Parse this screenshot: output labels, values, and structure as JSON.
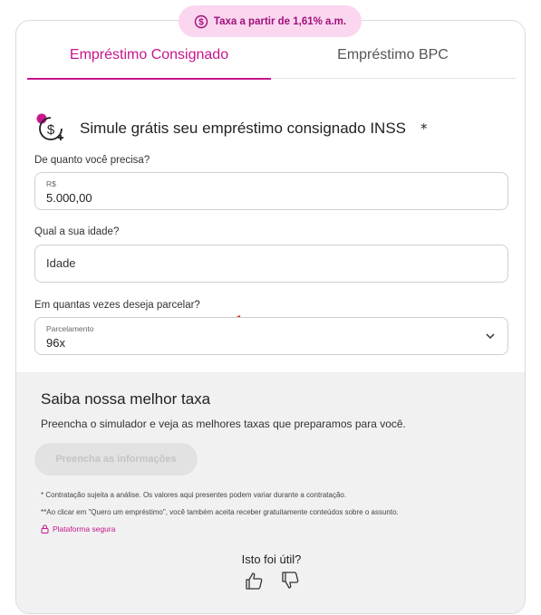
{
  "rate_pill": {
    "icon": "dollar-circle-icon",
    "text": "Taxa a partir de 1,61% a.m."
  },
  "tabs": [
    {
      "label": "Empréstimo Consignado",
      "active": true
    },
    {
      "label": "Empréstimo BPC",
      "active": false
    }
  ],
  "simulator": {
    "icon": "dollar-refresh-icon",
    "title": "Simule grátis seu empréstimo consignado INSS",
    "required_mark": "*"
  },
  "amount": {
    "label": "De quanto você precisa?",
    "currency": "R$",
    "value": "5.000,00"
  },
  "age": {
    "label": "Qual a sua idade?",
    "placeholder": "Idade"
  },
  "installments": {
    "label": "Em quantas vezes deseja parcelar?",
    "field_label": "Parcelamento",
    "value": "96x"
  },
  "best_rate": {
    "title": "Saiba nossa melhor taxa",
    "subtitle": "Preencha o simulador e veja as melhores taxas que preparamos para você.",
    "button_label": "Preencha as informações"
  },
  "notes": [
    "* Contratação sujeita a análise. Os valores aqui presentes podem variar durante a contratação.",
    "**Ao clicar em \"Quero um empréstimo\", você também aceita receber gratuitamente conteúdos sobre o assunto."
  ],
  "secure_label": "Plataforma segura",
  "feedback": {
    "question": "Isto foi útil?"
  },
  "colors": {
    "accent": "#c7168c",
    "pill_bg": "#fad6ef",
    "arrow": "#e01919",
    "section_bg": "#f1f1f1"
  }
}
